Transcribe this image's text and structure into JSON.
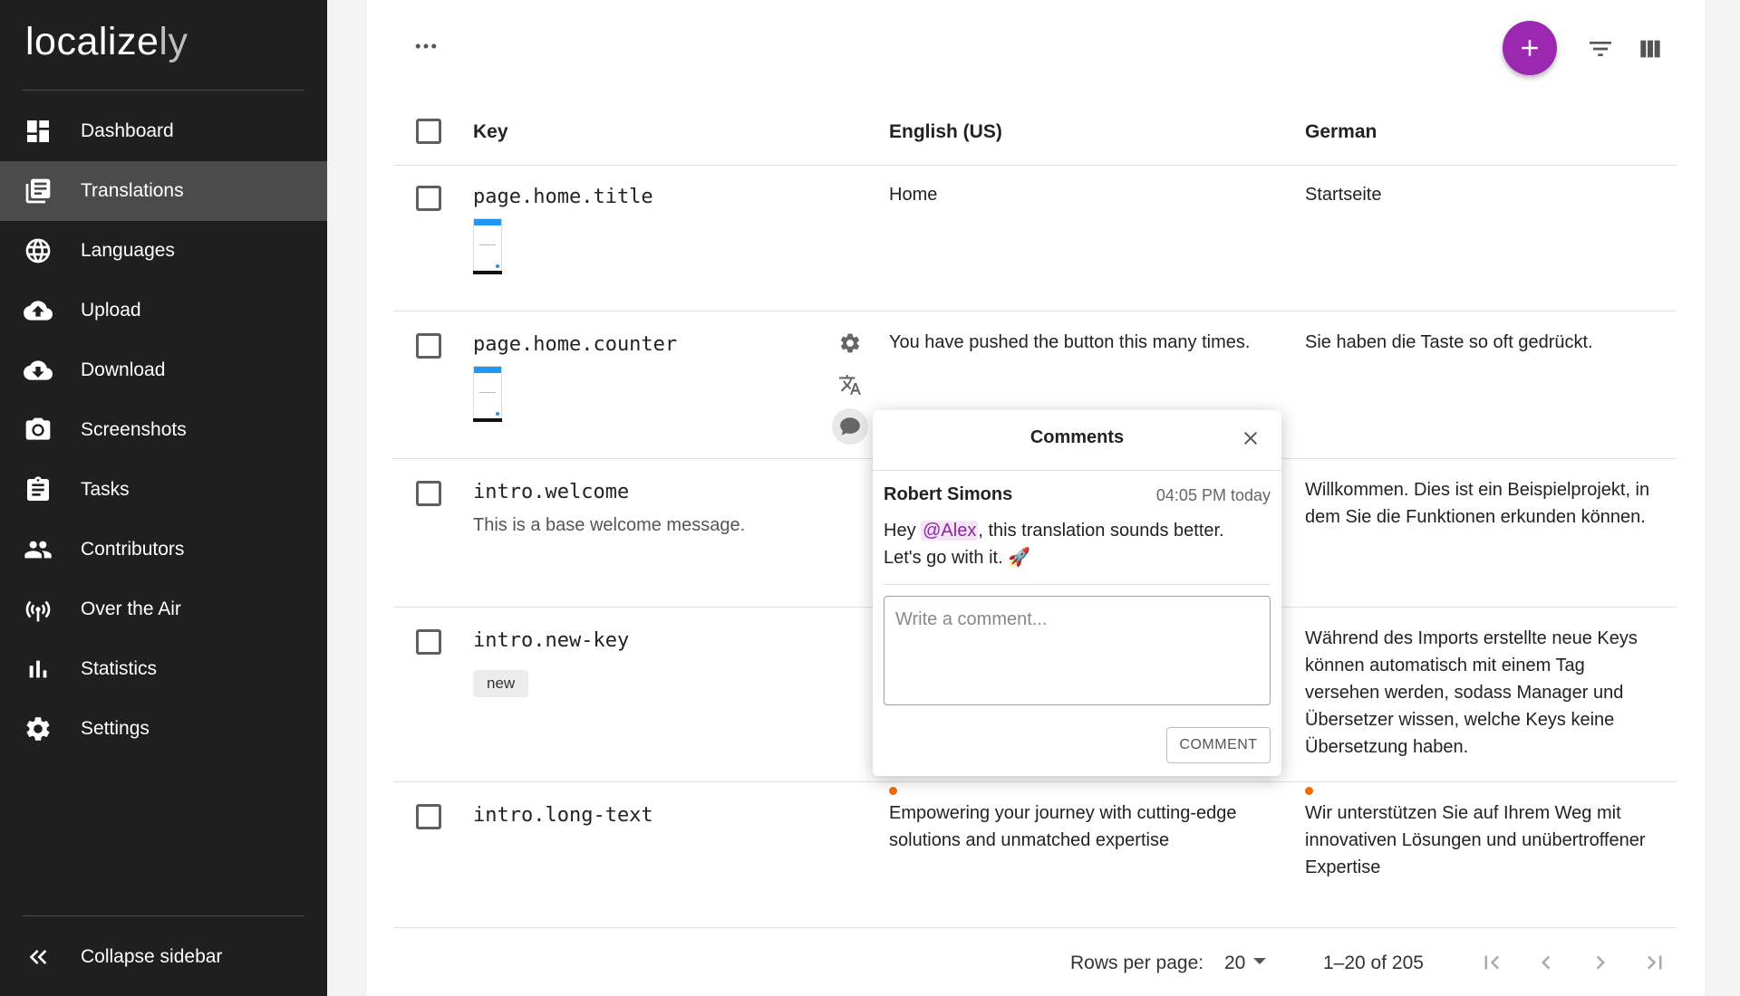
{
  "brand": {
    "logo_main": "localize",
    "logo_tail": "ly"
  },
  "sidebar": {
    "items": [
      {
        "label": "Dashboard",
        "icon": "dashboard-icon"
      },
      {
        "label": "Translations",
        "icon": "translations-icon",
        "active": true
      },
      {
        "label": "Languages",
        "icon": "globe-icon"
      },
      {
        "label": "Upload",
        "icon": "cloud-upload-icon"
      },
      {
        "label": "Download",
        "icon": "cloud-download-icon"
      },
      {
        "label": "Screenshots",
        "icon": "camera-icon"
      },
      {
        "label": "Tasks",
        "icon": "clipboard-icon"
      },
      {
        "label": "Contributors",
        "icon": "people-icon"
      },
      {
        "label": "Over the Air",
        "icon": "antenna-icon"
      },
      {
        "label": "Statistics",
        "icon": "bar-chart-icon"
      },
      {
        "label": "Settings",
        "icon": "gear-icon"
      }
    ],
    "collapse_label": "Collapse sidebar"
  },
  "toolbar": {
    "more_icon": "more-horizontal-icon",
    "add_icon": "plus-icon",
    "filter_icon": "filter-icon",
    "columns_icon": "columns-icon",
    "accent": "#9c27b0"
  },
  "table": {
    "headers": {
      "key": "Key",
      "english": "English (US)",
      "german": "German"
    },
    "rows": [
      {
        "key": "page.home.title",
        "english": "Home",
        "german": "Startseite"
      },
      {
        "key": "page.home.counter",
        "english": "You have pushed the button this many times.",
        "german": "Sie haben die Taste so oft gedrückt."
      },
      {
        "key": "intro.welcome",
        "description": "This is a base welcome message.",
        "english": "",
        "german": "Willkommen. Dies ist ein Beispielprojekt, in dem Sie die Funktionen erkunden können."
      },
      {
        "key": "intro.new-key",
        "tag": "new",
        "english": "",
        "german": "Während des Imports erstellte neue Keys können automatisch mit einem Tag versehen werden, sodass Manager und Übersetzer wissen, welche Keys keine Übersetzung haben."
      },
      {
        "key": "intro.long-text",
        "english": "Empowering your journey with cutting-edge solutions and unmatched expertise",
        "german": "Wir unterstützen Sie auf Ihrem Weg mit innovativen Lösungen und unübertroffener Expertise"
      }
    ]
  },
  "comments": {
    "title": "Comments",
    "author": "Robert Simons",
    "time": "04:05 PM today",
    "message_pre": "Hey ",
    "mention": "@Alex",
    "message_post": ", this translation sounds better. Let's go with it. 🚀",
    "placeholder": "Write a comment...",
    "button": "COMMENT"
  },
  "pagination": {
    "rows_per_page_label": "Rows per page:",
    "rows_per_page": "20",
    "range": "1–20 of 205"
  }
}
